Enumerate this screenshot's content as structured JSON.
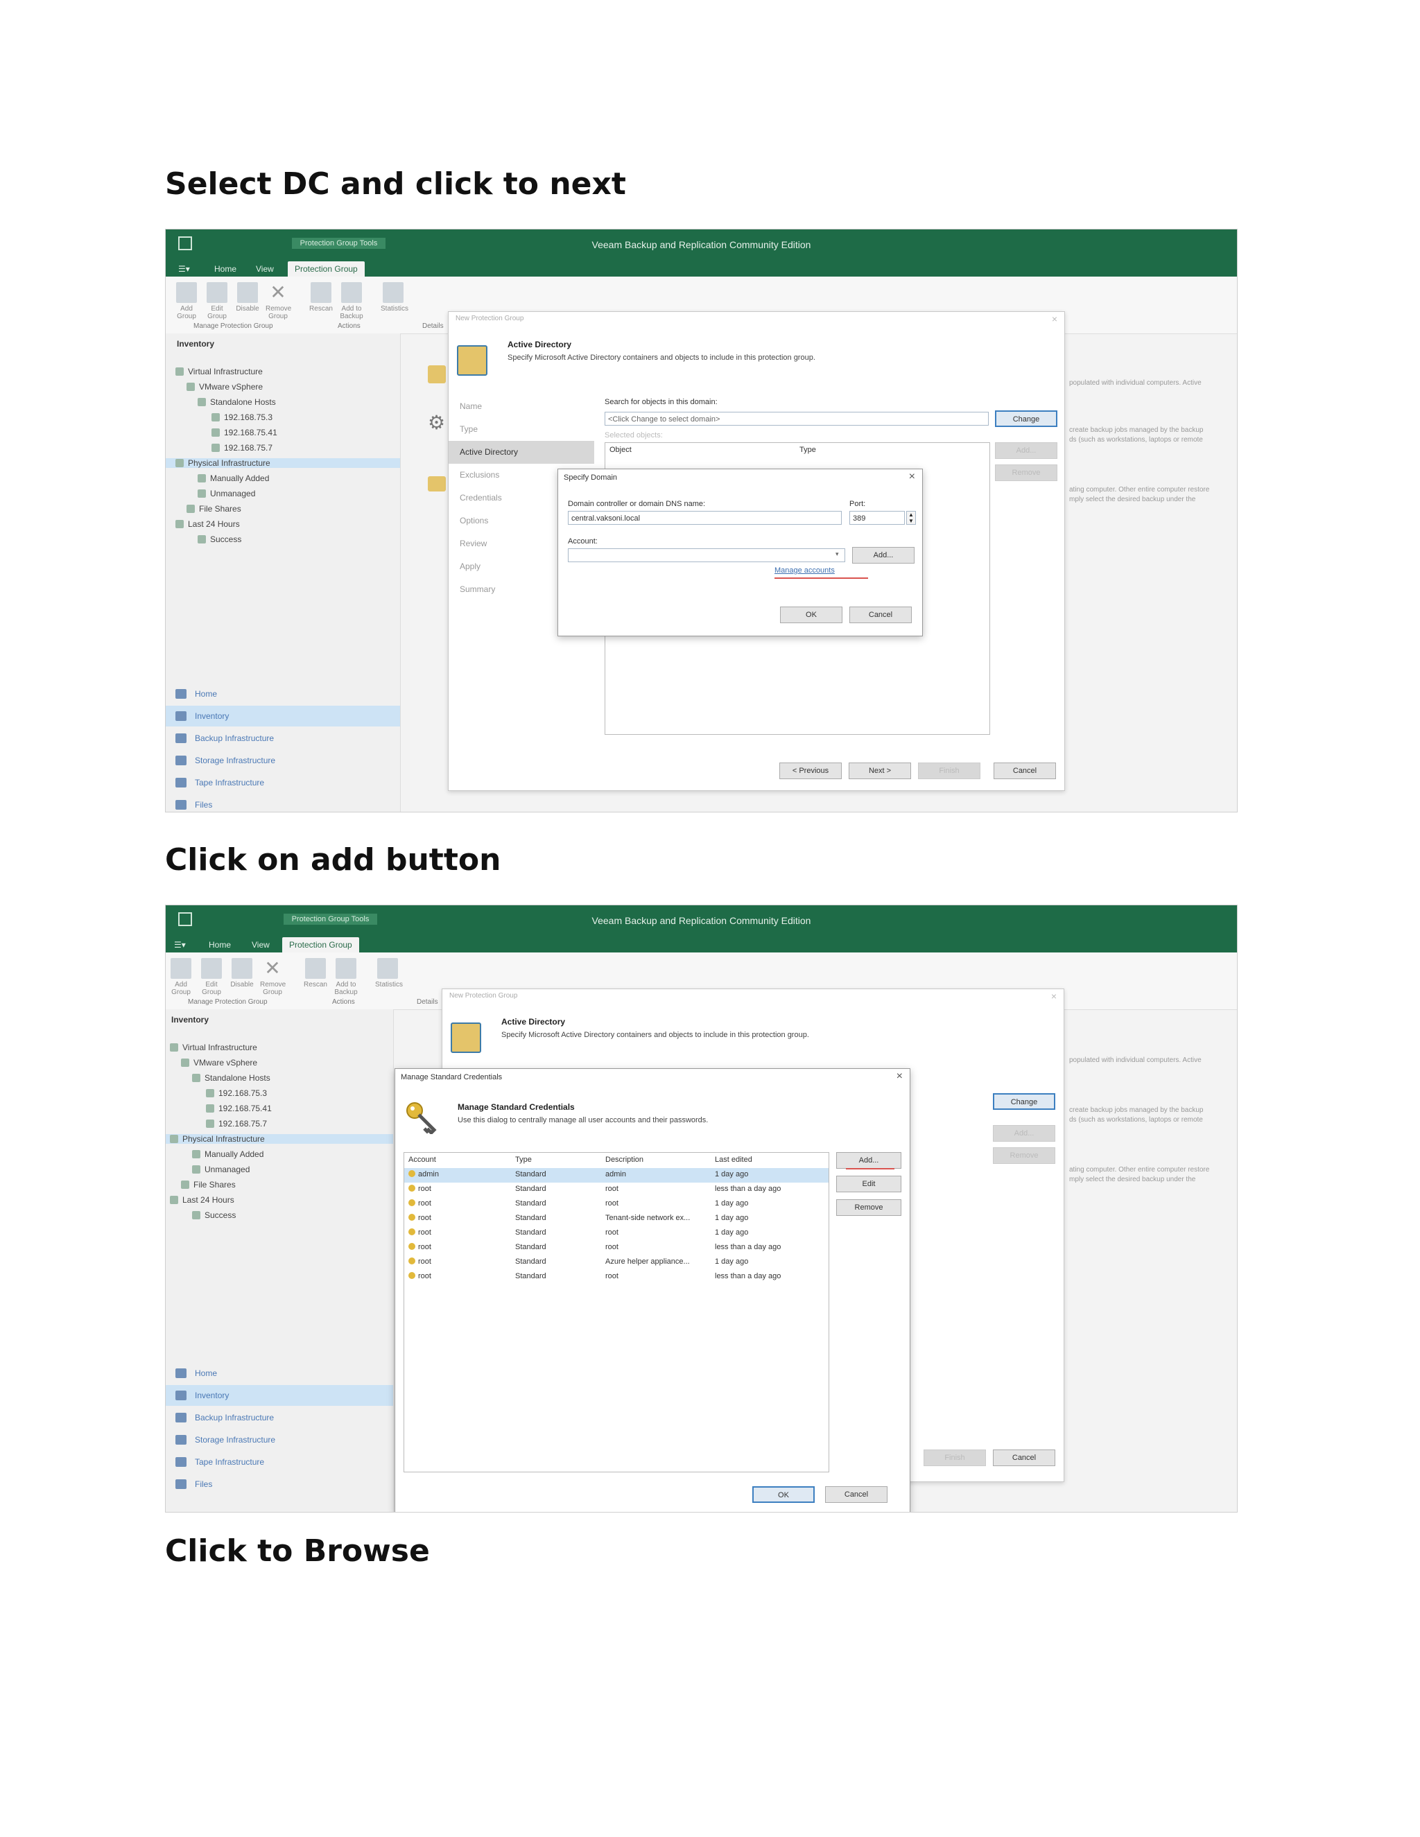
{
  "headings": {
    "step1": "Select DC and click to next",
    "step2": "Click on add button",
    "step3": "Click to Browse"
  },
  "app": {
    "title": "Veeam Backup and Replication Community Edition",
    "context_tab_group": "Protection Group Tools",
    "menu_icon": "menu-icon",
    "tabs": [
      "Home",
      "View",
      "Protection Group"
    ]
  },
  "ribbon": {
    "buttons": [
      {
        "label": "Add Group",
        "icon": "add-group-icon"
      },
      {
        "label": "Edit Group",
        "icon": "edit-group-icon"
      },
      {
        "label": "Disable",
        "icon": "disable-icon"
      },
      {
        "label": "Remove Group",
        "icon": "remove-icon"
      },
      {
        "label": "Rescan",
        "icon": "rescan-icon"
      },
      {
        "label": "Add to Backup",
        "icon": "add-to-backup-icon"
      },
      {
        "label": "Statistics",
        "icon": "statistics-icon"
      }
    ],
    "groups": [
      "Manage Protection Group",
      "Actions",
      "Details"
    ]
  },
  "inventory": {
    "title": "Inventory",
    "tree": [
      {
        "label": "Virtual Infrastructure",
        "level": 0
      },
      {
        "label": "VMware vSphere",
        "level": 1
      },
      {
        "label": "Standalone Hosts",
        "level": 2
      },
      {
        "label": "192.168.75.3",
        "level": 3
      },
      {
        "label": "192.168.75.41",
        "level": 3
      },
      {
        "label": "192.168.75.7",
        "level": 3
      },
      {
        "label": "Physical Infrastructure",
        "level": 0
      },
      {
        "label": "Manually Added",
        "level": 1
      },
      {
        "label": "Unmanaged",
        "level": 1
      },
      {
        "label": "File Shares",
        "level": 0
      },
      {
        "label": "Last 24 Hours",
        "level": 0
      },
      {
        "label": "Success",
        "level": 1
      }
    ]
  },
  "nav": [
    "Home",
    "Inventory",
    "Backup Infrastructure",
    "Storage Infrastructure",
    "Tape Infrastructure",
    "Files"
  ],
  "right_desc": [
    "populated with individual computers. Active",
    "create backup jobs managed by the backup",
    "ds (such as workstations, laptops or remote",
    "ating computer. Other entire computer restore",
    "mply select the desired backup under the"
  ],
  "wizard": {
    "title": "New Protection Group",
    "header_title": "Active Directory",
    "header_sub": "Specify Microsoft Active Directory containers and objects to include in this protection group.",
    "steps": [
      "Name",
      "Type",
      "Active Directory",
      "Exclusions",
      "Credentials",
      "Options",
      "Review",
      "Apply",
      "Summary"
    ],
    "search_label": "Search for objects in this domain:",
    "search_value": "<Click Change to select domain>",
    "change_button": "Change",
    "selected_objects_label": "Selected objects:",
    "columns": [
      "Object",
      "Type"
    ],
    "side_buttons": [
      "Add...",
      "Remove"
    ],
    "footer_buttons": [
      "< Previous",
      "Next >",
      "Finish",
      "Cancel"
    ]
  },
  "specify_domain": {
    "title": "Specify Domain",
    "dc_label": "Domain controller or domain DNS name:",
    "dc_value": "central.vaksoni.local",
    "port_label": "Port:",
    "port_value": "389",
    "account_label": "Account:",
    "account_value": "",
    "add_button": "Add...",
    "manage_link": "Manage accounts",
    "ok_button": "OK",
    "cancel_button": "Cancel"
  },
  "credentials": {
    "title": "Manage Standard Credentials",
    "header_title": "Manage Standard Credentials",
    "header_sub": "Use this dialog to centrally manage all user accounts and their passwords.",
    "columns": [
      "Account",
      "Type",
      "Description",
      "Last edited"
    ],
    "rows": [
      {
        "account": "admin",
        "type": "Standard",
        "description": "admin",
        "last_edited": "1 day ago"
      },
      {
        "account": "root",
        "type": "Standard",
        "description": "root",
        "last_edited": "less than a day ago"
      },
      {
        "account": "root",
        "type": "Standard",
        "description": "root",
        "last_edited": "1 day ago"
      },
      {
        "account": "root",
        "type": "Standard",
        "description": "Tenant-side network ex...",
        "last_edited": "1 day ago"
      },
      {
        "account": "root",
        "type": "Standard",
        "description": "root",
        "last_edited": "1 day ago"
      },
      {
        "account": "root",
        "type": "Standard",
        "description": "root",
        "last_edited": "less than a day ago"
      },
      {
        "account": "root",
        "type": "Standard",
        "description": "Azure helper appliance...",
        "last_edited": "1 day ago"
      },
      {
        "account": "root",
        "type": "Standard",
        "description": "root",
        "last_edited": "less than a day ago"
      }
    ],
    "buttons": [
      "Add...",
      "Edit",
      "Remove"
    ],
    "ok_button": "OK",
    "cancel_button": "Cancel"
  },
  "colors": {
    "titlebar": "#1e6b47",
    "selection": "#cde3f5",
    "accent_blue": "#3c7fc0",
    "annotation_red": "#d9534f"
  }
}
